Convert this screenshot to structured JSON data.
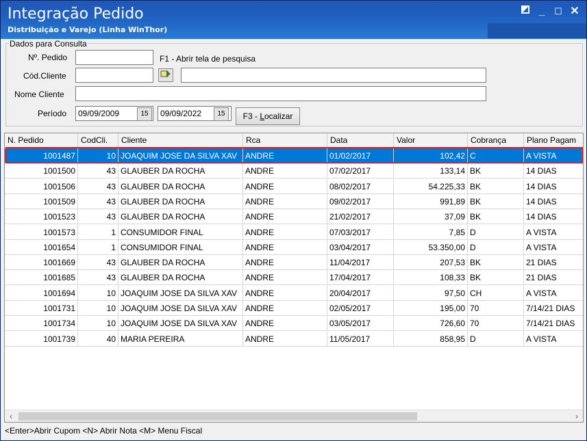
{
  "window": {
    "title": "Integração Pedido",
    "subtitle": "Distribuição e Varejo (Linha WinThor)"
  },
  "query": {
    "group_title": "Dados para Consulta",
    "pedido_label": "Nº. Pedido",
    "pedido_value": "",
    "pedido_hint": "F1 - Abrir tela de pesquisa",
    "cliente_label": "Cód.Cliente",
    "cliente_value": "",
    "cliente_desc_value": "",
    "nome_label": "Nome Cliente",
    "nome_value": "",
    "periodo_label": "Período",
    "date_from": "09/09/2009",
    "date_to": "09/09/2022",
    "localizar_prefix": "F3 - ",
    "localizar_key": "L",
    "localizar_rest": "ocalizar"
  },
  "grid": {
    "columns": [
      "N. Pedido",
      "CodCli.",
      "Cliente",
      "Rca",
      "Data",
      "Valor",
      "Cobrança",
      "Plano Pagam"
    ],
    "rows": [
      [
        "1001487",
        "10",
        "JOAQUIM JOSE DA SILVA XAV",
        "ANDRE",
        "01/02/2017",
        "102,42",
        "C",
        "A VISTA"
      ],
      [
        "1001500",
        "43",
        "GLAUBER DA ROCHA",
        "ANDRE",
        "07/02/2017",
        "133,14",
        "BK",
        "14 DIAS"
      ],
      [
        "1001506",
        "43",
        "GLAUBER DA ROCHA",
        "ANDRE",
        "08/02/2017",
        "54.225,33",
        "BK",
        "14 DIAS"
      ],
      [
        "1001509",
        "43",
        "GLAUBER DA ROCHA",
        "ANDRE",
        "09/02/2017",
        "991,89",
        "BK",
        "14 DIAS"
      ],
      [
        "1001523",
        "43",
        "GLAUBER DA ROCHA",
        "ANDRE",
        "21/02/2017",
        "37,09",
        "BK",
        "14 DIAS"
      ],
      [
        "1001573",
        "1",
        "CONSUMIDOR FINAL",
        "ANDRE",
        "07/03/2017",
        "7,85",
        "D",
        "A VISTA"
      ],
      [
        "1001654",
        "1",
        "CONSUMIDOR FINAL",
        "ANDRE",
        "03/04/2017",
        "53.350,00",
        "D",
        "A VISTA"
      ],
      [
        "1001669",
        "43",
        "GLAUBER DA ROCHA",
        "ANDRE",
        "11/04/2017",
        "207,53",
        "BK",
        "21 DIAS"
      ],
      [
        "1001685",
        "43",
        "GLAUBER DA ROCHA",
        "ANDRE",
        "17/04/2017",
        "108,33",
        "BK",
        "21 DIAS"
      ],
      [
        "1001694",
        "10",
        "JOAQUIM JOSE DA SILVA XAV",
        "ANDRE",
        "20/04/2017",
        "97,50",
        "CH",
        "A VISTA"
      ],
      [
        "1001731",
        "10",
        "JOAQUIM JOSE DA SILVA XAV",
        "ANDRE",
        "02/05/2017",
        "195,00",
        "70",
        "7/14/21 DIAS"
      ],
      [
        "1001734",
        "10",
        "JOAQUIM JOSE DA SILVA XAV",
        "ANDRE",
        "03/05/2017",
        "726,60",
        "70",
        "7/14/21 DIAS"
      ],
      [
        "1001739",
        "40",
        "MARIA PEREIRA",
        "ANDRE",
        "11/05/2017",
        "858,95",
        "D",
        "A VISTA"
      ]
    ],
    "selected_row": 0
  },
  "statusbar": {
    "text": "<Enter>Abrir Cupom   <N> Abrir Nota   <M> Menu Fiscal"
  },
  "icons": {
    "calendar": "calendar-icon",
    "search": "search-hand-icon",
    "minimize": "minimize-icon",
    "maximize": "maximize-icon",
    "close": "close-icon"
  },
  "colors": {
    "title_bar": "#1e5fbf",
    "selection": "#0078d7",
    "highlight_outline": "#e02020"
  }
}
